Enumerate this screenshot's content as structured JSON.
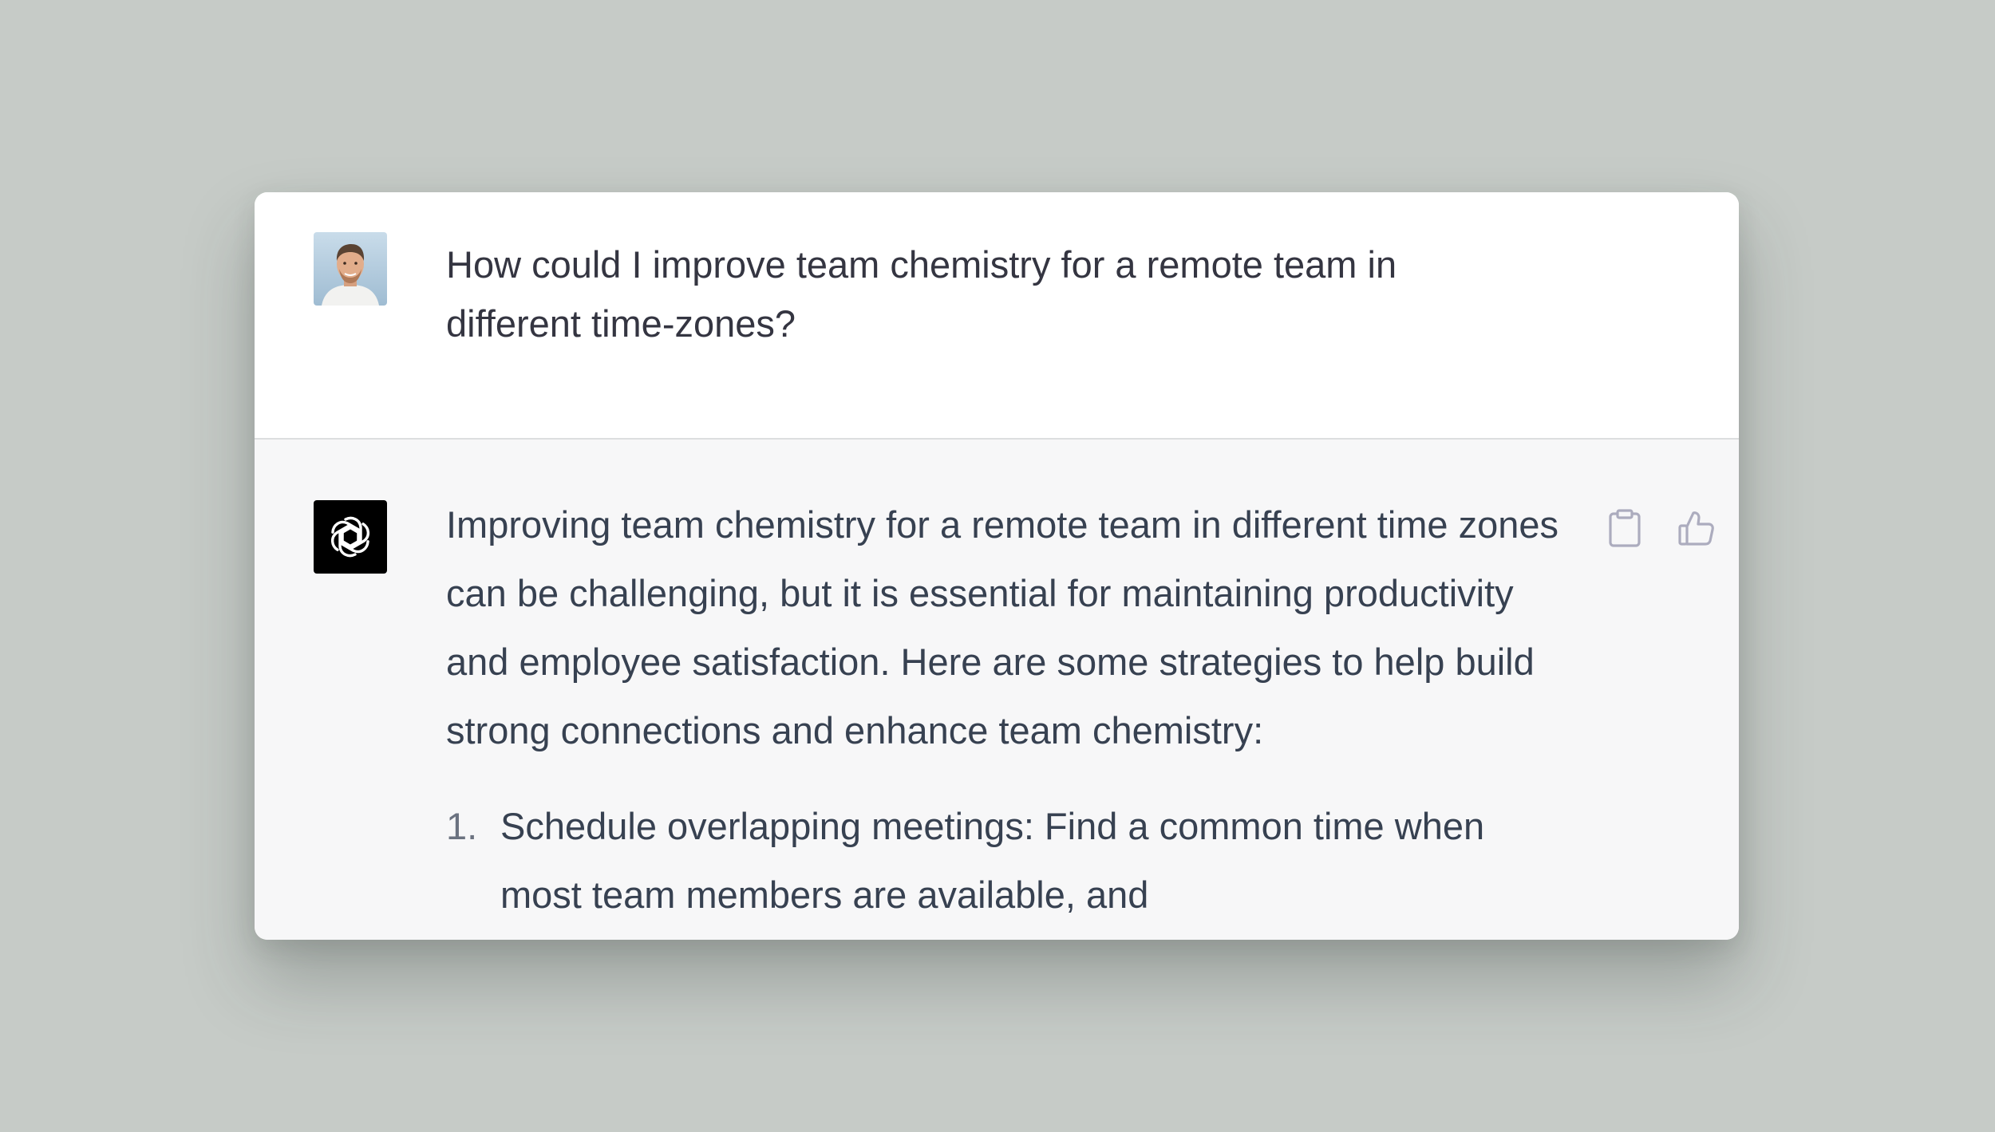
{
  "conversation": {
    "user_message": {
      "text": "How could I improve team chemistry for a remote team in different time-zones?",
      "avatar_icon": "user-avatar-photo"
    },
    "assistant_message": {
      "avatar_icon": "openai-logo-icon",
      "intro": "Improving team chemistry for a remote team in different time zones can be challenging, but it is essential for maintaining productivity and employee satisfaction. Here are some strategies to help build strong connections and enhance team chemistry:",
      "items": [
        {
          "number": "1.",
          "text": "Schedule overlapping meetings: Find a common time when most team members are available, and"
        }
      ],
      "actions": {
        "copy_icon": "clipboard-icon",
        "like_icon": "thumbs-up-icon"
      }
    }
  },
  "colors": {
    "page_background": "#c6cbc7",
    "user_background": "#ffffff",
    "assistant_background": "#f7f7f8",
    "text": "#374151",
    "icon": "#acacbe"
  }
}
